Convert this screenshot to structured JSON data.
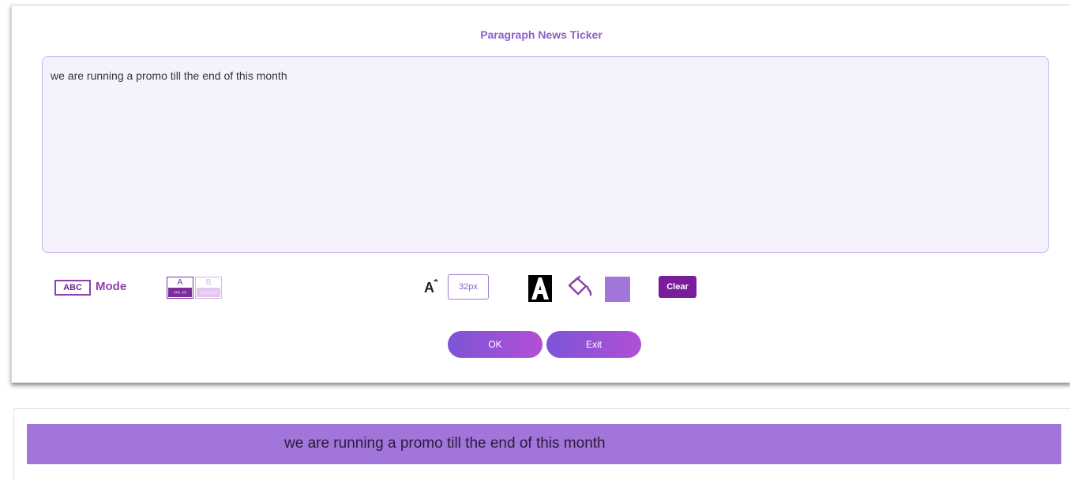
{
  "dialog": {
    "title": "Paragraph News Ticker",
    "editor_text": "we are running a promo till the end of this month",
    "mode": {
      "box_label": "ABC",
      "label": "Mode"
    },
    "ab_toggle": {
      "a_label": "A",
      "b_label": "B",
      "a_icon": "scroll-left-icon",
      "b_icon": "static-icon"
    },
    "font_size": "32px",
    "text_color": "#000000",
    "background_color": "#a175d9",
    "clear_label": "Clear",
    "ok_label": "OK",
    "exit_label": "Exit"
  },
  "preview": {
    "ticker_text": "we are running a promo till the end of this month",
    "background_color": "#a175d9"
  },
  "colors": {
    "accent": "#8e5ec9",
    "clear_button": "#7a1d9b",
    "editor_bg": "#f6f2fd",
    "button_gradient_start": "#7c55d6",
    "button_gradient_end": "#b14fd6"
  }
}
